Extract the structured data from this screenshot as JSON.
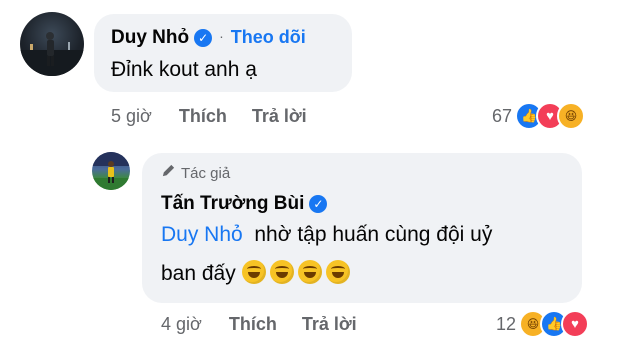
{
  "comment1": {
    "author": "Duy Nhỏ",
    "separator": "·",
    "follow_label": "Theo dõi",
    "text": "Đỉnk kout anh ạ",
    "time": "5 giờ",
    "like_label": "Thích",
    "reply_label": "Trả lời",
    "reaction_count": "67",
    "reactions": [
      "like-icon",
      "love-icon",
      "haha-icon"
    ]
  },
  "comment2": {
    "badge_label": "Tác giả",
    "author": "Tấn Trường Bùi",
    "mention": "Duy Nhỏ",
    "text_line1": "nhờ tập huấn cùng đội uỷ",
    "text_line2": "ban đấy",
    "emoji_count": 4,
    "emoji": "rolling-on-floor-laughing",
    "time": "4 giờ",
    "like_label": "Thích",
    "reply_label": "Trả lời",
    "reaction_count": "12",
    "reactions": [
      "haha-icon",
      "like-icon",
      "love-icon"
    ]
  },
  "colors": {
    "bubble": "#f0f2f5",
    "link": "#1877f2",
    "meta": "#65676b",
    "like": "#1877f2",
    "love": "#f33e58",
    "haha": "#f7b125"
  }
}
